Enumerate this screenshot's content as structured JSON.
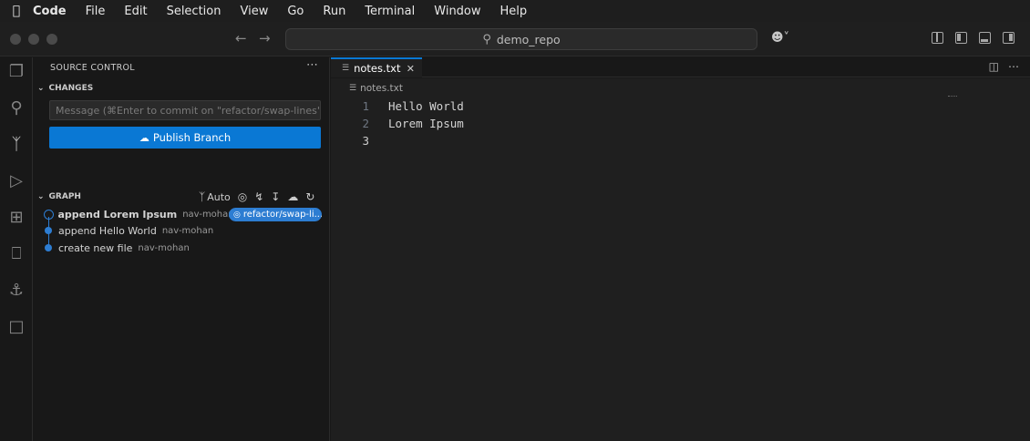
{
  "menubar": {
    "app": "Code",
    "items": [
      "File",
      "Edit",
      "Selection",
      "View",
      "Go",
      "Run",
      "Terminal",
      "Window",
      "Help"
    ]
  },
  "titlebar": {
    "search_text": "demo_repo"
  },
  "sidebar": {
    "title": "SOURCE CONTROL",
    "changes_header": "CHANGES",
    "commit_placeholder": "Message (⌘Enter to commit on \"refactor/swap-lines\")",
    "publish_label": "Publish Branch",
    "graph_header": "GRAPH",
    "graph_auto_label": "Auto",
    "branch_badge": "refactor/swap-li...",
    "commits": [
      {
        "message": "append Lorem Ipsum",
        "author": "nav-mohan"
      },
      {
        "message": "append Hello World",
        "author": "nav-mohan"
      },
      {
        "message": "create new file",
        "author": "nav-mohan"
      }
    ]
  },
  "editor": {
    "tab_label": "notes.txt",
    "breadcrumb": "notes.txt",
    "lines": [
      {
        "num": "1",
        "text": "Hello World"
      },
      {
        "num": "2",
        "text": "Lorem Ipsum"
      },
      {
        "num": "3",
        "text": ""
      }
    ]
  },
  "colors": {
    "accent": "#0a78d4",
    "graph": "#2d7dd2",
    "background": "#181818",
    "editor_bg": "#1f1f1f"
  }
}
